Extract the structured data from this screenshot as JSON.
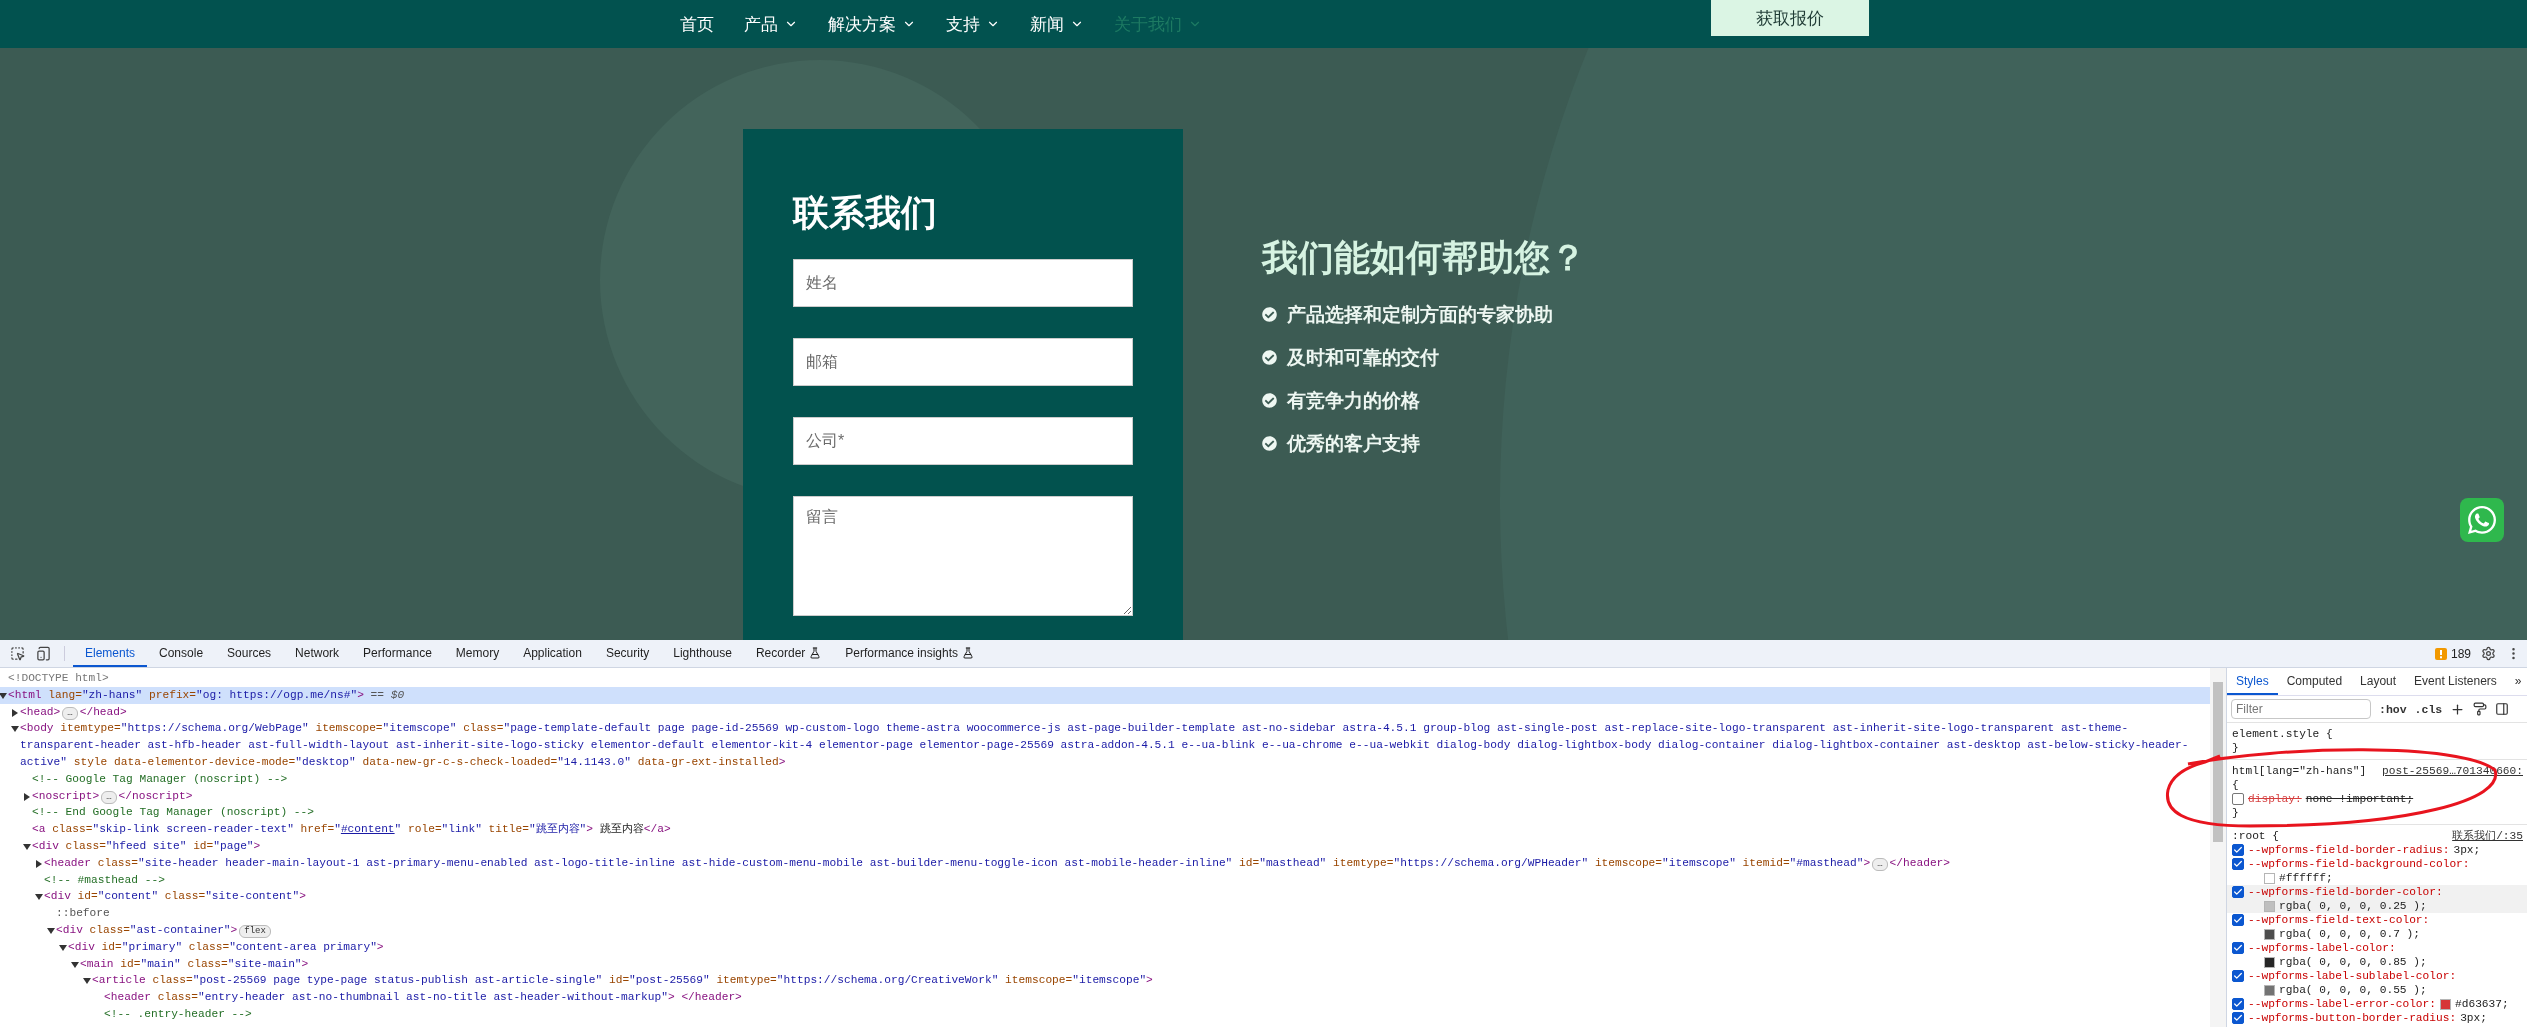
{
  "nav": {
    "items": [
      {
        "label": "首页",
        "dropdown": false,
        "selected": false
      },
      {
        "label": "产品",
        "dropdown": true,
        "selected": false
      },
      {
        "label": "解决方案",
        "dropdown": true,
        "selected": false
      },
      {
        "label": "支持",
        "dropdown": true,
        "selected": false
      },
      {
        "label": "新闻",
        "dropdown": true,
        "selected": false
      },
      {
        "label": "关于我们",
        "dropdown": true,
        "selected": true
      }
    ],
    "cta": "获取报价"
  },
  "contact_form": {
    "title": "联系我们",
    "fields": [
      {
        "kind": "input",
        "placeholder": "姓名"
      },
      {
        "kind": "input",
        "placeholder": "邮箱"
      },
      {
        "kind": "input",
        "placeholder": "公司*"
      },
      {
        "kind": "textarea",
        "placeholder": "留言"
      }
    ]
  },
  "help": {
    "title": "我们能如何帮助您？",
    "items": [
      "产品选择和定制方面的专家协助",
      "及时和可靠的交付",
      "有竞争力的价格",
      "优秀的客户支持"
    ]
  },
  "devtools": {
    "tabs": [
      {
        "label": "Elements",
        "selected": true,
        "beta": false
      },
      {
        "label": "Console",
        "selected": false,
        "beta": false
      },
      {
        "label": "Sources",
        "selected": false,
        "beta": false
      },
      {
        "label": "Network",
        "selected": false,
        "beta": false
      },
      {
        "label": "Performance",
        "selected": false,
        "beta": false
      },
      {
        "label": "Memory",
        "selected": false,
        "beta": false
      },
      {
        "label": "Application",
        "selected": false,
        "beta": false
      },
      {
        "label": "Security",
        "selected": false,
        "beta": false
      },
      {
        "label": "Lighthouse",
        "selected": false,
        "beta": false
      },
      {
        "label": "Recorder",
        "selected": false,
        "beta": true
      },
      {
        "label": "Performance insights",
        "selected": false,
        "beta": true
      }
    ],
    "issues_count": "189",
    "dom": [
      {
        "selected": false,
        "parts": [
          {
            "kind": "doctype",
            "text": "<!DOCTYPE html>"
          }
        ]
      },
      {
        "selected": true,
        "expanded": true,
        "parts": [
          {
            "kind": "tag",
            "text": "<html"
          },
          {
            "kind": "attr",
            "text": " lang="
          },
          {
            "kind": "value",
            "text": "\"zh-hans\""
          },
          {
            "kind": "attr",
            "text": " prefix="
          },
          {
            "kind": "value",
            "text": "\"og: https://ogp.me/ns#\""
          },
          {
            "kind": "tag",
            "text": ">"
          },
          {
            "kind": "dollar",
            "text": " == $0"
          }
        ],
        "children": [
          {
            "selected": false,
            "expanded": false,
            "parts": [
              {
                "kind": "tag",
                "text": "<head>"
              }
            ],
            "badge": "…",
            "after": [
              {
                "kind": "tag",
                "text": "</head>"
              }
            ]
          },
          {
            "selected": false,
            "expanded": true,
            "parts": [
              {
                "kind": "tag",
                "text": "<body"
              },
              {
                "kind": "attr",
                "text": " itemtype="
              },
              {
                "kind": "value",
                "text": "\"https://schema.org/WebPage\""
              },
              {
                "kind": "attr",
                "text": " itemscope="
              },
              {
                "kind": "value",
                "text": "\"itemscope\""
              },
              {
                "kind": "attr",
                "text": " class="
              },
              {
                "kind": "value",
                "text": "\"page-template-default page page-id-25569 wp-custom-logo theme-astra woocommerce-js ast-page-builder-template ast-no-sidebar astra-4.5.1 group-blog ast-single-post ast-replace-site-logo-transparent ast-inherit-site-logo-transparent ast-theme-transparent-header ast-hfb-header ast-full-width-layout ast-inherit-site-logo-sticky elementor-default elementor-kit-4 elementor-page elementor-page-25569 astra-addon-4.5.1 e--ua-blink e--ua-chrome e--ua-webkit dialog-body dialog-lightbox-body dialog-container dialog-lightbox-container ast-desktop ast-below-sticky-header-active\""
              },
              {
                "kind": "attr",
                "text": " style data-elementor-device-mode="
              },
              {
                "kind": "value",
                "text": "\"desktop\""
              },
              {
                "kind": "attr",
                "text": " data-new-gr-c-s-check-loaded="
              },
              {
                "kind": "value",
                "text": "\"14.1143.0\""
              },
              {
                "kind": "attr",
                "text": " data-gr-ext-installed"
              },
              {
                "kind": "tag",
                "text": ">"
              }
            ],
            "children": [
              {
                "selected": false,
                "parts": [
                  {
                    "kind": "comment",
                    "text": "<!-- Google Tag Manager (noscript) -->"
                  }
                ]
              },
              {
                "selected": false,
                "expanded": false,
                "parts": [
                  {
                    "kind": "tag",
                    "text": "<noscript>"
                  }
                ],
                "badge": "…",
                "after": [
                  {
                    "kind": "tag",
                    "text": "</noscript>"
                  }
                ]
              },
              {
                "selected": false,
                "parts": [
                  {
                    "kind": "comment",
                    "text": "<!-- End Google Tag Manager (noscript) -->"
                  }
                ]
              },
              {
                "selected": false,
                "parts": [
                  {
                    "kind": "tag",
                    "text": "<a"
                  },
                  {
                    "kind": "attr",
                    "text": " class="
                  },
                  {
                    "kind": "value",
                    "text": "\"skip-link screen-reader-text\""
                  },
                  {
                    "kind": "attr",
                    "text": " href="
                  },
                  {
                    "kind": "value",
                    "text": "\""
                  },
                  {
                    "kind": "link",
                    "text": "#content"
                  },
                  {
                    "kind": "value",
                    "text": "\""
                  },
                  {
                    "kind": "attr",
                    "text": " role="
                  },
                  {
                    "kind": "value",
                    "text": "\"link\""
                  },
                  {
                    "kind": "attr",
                    "text": " title="
                  },
                  {
                    "kind": "value",
                    "text": "\"跳至内容\""
                  },
                  {
                    "kind": "tag",
                    "text": ">"
                  },
                  {
                    "kind": "text",
                    "text": " 跳至内容"
                  },
                  {
                    "kind": "tag",
                    "text": "</a>"
                  }
                ]
              },
              {
                "selected": false,
                "expanded": true,
                "parts": [
                  {
                    "kind": "tag",
                    "text": "<div"
                  },
                  {
                    "kind": "attr",
                    "text": " class="
                  },
                  {
                    "kind": "value",
                    "text": "\"hfeed site\""
                  },
                  {
                    "kind": "attr",
                    "text": " id="
                  },
                  {
                    "kind": "value",
                    "text": "\"page\""
                  },
                  {
                    "kind": "tag",
                    "text": ">"
                  }
                ],
                "children": [
                  {
                    "selected": false,
                    "expanded": false,
                    "parts": [
                      {
                        "kind": "tag",
                        "text": "<header"
                      },
                      {
                        "kind": "attr",
                        "text": " class="
                      },
                      {
                        "kind": "value",
                        "text": "\"site-header header-main-layout-1 ast-primary-menu-enabled ast-logo-title-inline ast-hide-custom-menu-mobile ast-builder-menu-toggle-icon ast-mobile-header-inline\""
                      },
                      {
                        "kind": "attr",
                        "text": " id="
                      },
                      {
                        "kind": "value",
                        "text": "\"masthead\""
                      },
                      {
                        "kind": "attr",
                        "text": " itemtype="
                      },
                      {
                        "kind": "value",
                        "text": "\"https://schema.org/WPHeader\""
                      },
                      {
                        "kind": "attr",
                        "text": " itemscope="
                      },
                      {
                        "kind": "value",
                        "text": "\"itemscope\""
                      },
                      {
                        "kind": "attr",
                        "text": " itemid="
                      },
                      {
                        "kind": "value",
                        "text": "\"#masthead\""
                      },
                      {
                        "kind": "tag",
                        "text": ">"
                      }
                    ],
                    "badge": "…",
                    "after": [
                      {
                        "kind": "tag",
                        "text": "</header>"
                      }
                    ]
                  },
                  {
                    "selected": false,
                    "parts": [
                      {
                        "kind": "comment",
                        "text": "<!-- #masthead -->"
                      }
                    ]
                  },
                  {
                    "selected": false,
                    "expanded": true,
                    "parts": [
                      {
                        "kind": "tag",
                        "text": "<div"
                      },
                      {
                        "kind": "attr",
                        "text": " id="
                      },
                      {
                        "kind": "value",
                        "text": "\"content\""
                      },
                      {
                        "kind": "attr",
                        "text": " class="
                      },
                      {
                        "kind": "value",
                        "text": "\"site-content\""
                      },
                      {
                        "kind": "tag",
                        "text": ">"
                      }
                    ],
                    "children": [
                      {
                        "selected": false,
                        "parts": [
                          {
                            "kind": "pseudo",
                            "text": "::before"
                          }
                        ]
                      },
                      {
                        "selected": false,
                        "expanded": true,
                        "parts": [
                          {
                            "kind": "tag",
                            "text": "<div"
                          },
                          {
                            "kind": "attr",
                            "text": " class="
                          },
                          {
                            "kind": "value",
                            "text": "\"ast-container\""
                          },
                          {
                            "kind": "tag",
                            "text": ">"
                          }
                        ],
                        "badge": "flex",
                        "children": [
                          {
                            "selected": false,
                            "expanded": true,
                            "parts": [
                              {
                                "kind": "tag",
                                "text": "<div"
                              },
                              {
                                "kind": "attr",
                                "text": " id="
                              },
                              {
                                "kind": "value",
                                "text": "\"primary\""
                              },
                              {
                                "kind": "attr",
                                "text": " class="
                              },
                              {
                                "kind": "value",
                                "text": "\"content-area primary\""
                              },
                              {
                                "kind": "tag",
                                "text": ">"
                              }
                            ],
                            "children": [
                              {
                                "selected": false,
                                "expanded": true,
                                "parts": [
                                  {
                                    "kind": "tag",
                                    "text": "<main"
                                  },
                                  {
                                    "kind": "attr",
                                    "text": " id="
                                  },
                                  {
                                    "kind": "value",
                                    "text": "\"main\""
                                  },
                                  {
                                    "kind": "attr",
                                    "text": " class="
                                  },
                                  {
                                    "kind": "value",
                                    "text": "\"site-main\""
                                  },
                                  {
                                    "kind": "tag",
                                    "text": ">"
                                  }
                                ],
                                "children": [
                                  {
                                    "selected": false,
                                    "expanded": true,
                                    "parts": [
                                      {
                                        "kind": "tag",
                                        "text": "<article"
                                      },
                                      {
                                        "kind": "attr",
                                        "text": " class="
                                      },
                                      {
                                        "kind": "value",
                                        "text": "\"post-25569 page type-page status-publish ast-article-single\""
                                      },
                                      {
                                        "kind": "attr",
                                        "text": " id="
                                      },
                                      {
                                        "kind": "value",
                                        "text": "\"post-25569\""
                                      },
                                      {
                                        "kind": "attr",
                                        "text": " itemtype="
                                      },
                                      {
                                        "kind": "value",
                                        "text": "\"https://schema.org/CreativeWork\""
                                      },
                                      {
                                        "kind": "attr",
                                        "text": " itemscope="
                                      },
                                      {
                                        "kind": "value",
                                        "text": "\"itemscope\""
                                      },
                                      {
                                        "kind": "tag",
                                        "text": ">"
                                      }
                                    ],
                                    "children": [
                                      {
                                        "selected": false,
                                        "parts": [
                                          {
                                            "kind": "tag",
                                            "text": "<header"
                                          },
                                          {
                                            "kind": "attr",
                                            "text": " class="
                                          },
                                          {
                                            "kind": "value",
                                            "text": "\"entry-header ast-no-thumbnail ast-no-title ast-header-without-markup\""
                                          },
                                          {
                                            "kind": "tag",
                                            "text": ">"
                                          },
                                          {
                                            "kind": "tag",
                                            "text": " </header>"
                                          }
                                        ]
                                      },
                                      {
                                        "selected": false,
                                        "parts": [
                                          {
                                            "kind": "comment",
                                            "text": "<!-- .entry-header -->"
                                          }
                                        ]
                                      }
                                    ]
                                  }
                                ]
                              }
                            ]
                          }
                        ]
                      }
                    ]
                  }
                ]
              }
            ]
          }
        ]
      }
    ],
    "styles": {
      "tabs": [
        {
          "label": "Styles",
          "selected": true
        },
        {
          "label": "Computed",
          "selected": false
        },
        {
          "label": "Layout",
          "selected": false
        },
        {
          "label": "Event Listeners",
          "selected": false
        }
      ],
      "more": "»",
      "filter_placeholder": "Filter",
      "toggles": [
        ":hov",
        ".cls"
      ],
      "rules": [
        {
          "selector": "element.style {",
          "close": "}"
        },
        {
          "selector": "html[lang=\"zh-hans\"]",
          "source": "post-25569…701340660:",
          "open": "{",
          "declarations": [
            {
              "checked": false,
              "highlighted": false,
              "wrap": false,
              "prop": "display:",
              "value": "none !important;"
            }
          ],
          "close": "}"
        },
        {
          "selector": ":root {",
          "source": "联系我们/:35",
          "declarations": [
            {
              "checked": true,
              "highlighted": false,
              "wrap": false,
              "prop": "--wpforms-field-border-radius:",
              "value": "3px;"
            },
            {
              "checked": true,
              "highlighted": false,
              "wrap": true,
              "prop": "--wpforms-field-background-color:",
              "color": "#ffffff",
              "value": "#ffffff;"
            },
            {
              "checked": true,
              "highlighted": true,
              "wrap": true,
              "prop": "--wpforms-field-border-color:",
              "color": "#bfbfbf",
              "value": "rgba( 0, 0, 0, 0.25 );"
            },
            {
              "checked": true,
              "highlighted": false,
              "wrap": true,
              "prop": "--wpforms-field-text-color:",
              "color": "#4d4d4d",
              "value": "rgba( 0, 0, 0, 0.7 );"
            },
            {
              "checked": true,
              "highlighted": false,
              "wrap": true,
              "prop": "--wpforms-label-color:",
              "color": "#262626",
              "value": "rgba( 0, 0, 0, 0.85 );"
            },
            {
              "checked": true,
              "highlighted": false,
              "wrap": true,
              "prop": "--wpforms-label-sublabel-color:",
              "color": "#737373",
              "value": "rgba( 0, 0, 0, 0.55 );"
            },
            {
              "checked": true,
              "highlighted": false,
              "wrap": false,
              "prop": "--wpforms-label-error-color:",
              "color": "#d63637",
              "value": "#d63637;"
            },
            {
              "checked": true,
              "highlighted": false,
              "wrap": false,
              "prop": "--wpforms-button-border-radius:",
              "value": "3px;"
            }
          ]
        }
      ]
    }
  }
}
